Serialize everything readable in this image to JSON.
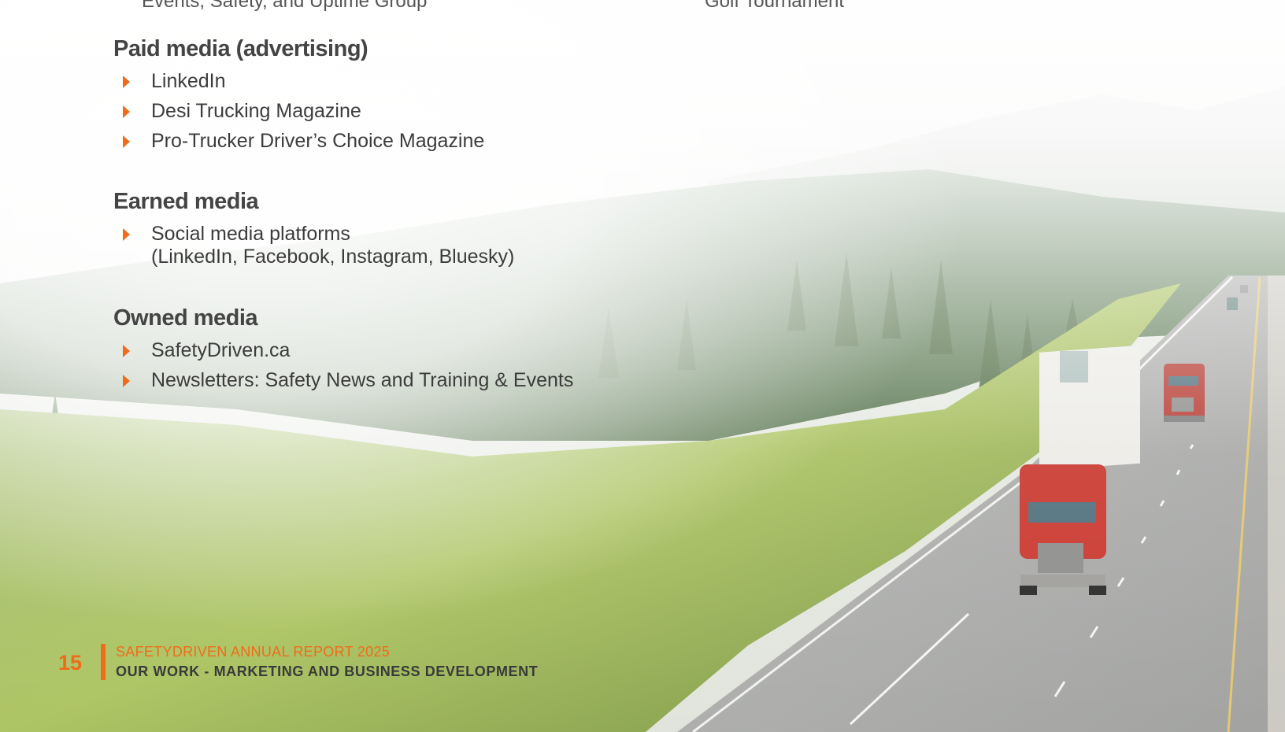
{
  "header_cut": {
    "left_text": "Events, Safety, and Uptime Group",
    "right_text": "Golf Tournament"
  },
  "sections": [
    {
      "heading": "Paid media (advertising)",
      "items": [
        "LinkedIn",
        "Desi Trucking Magazine",
        "Pro-Trucker Driver’s Choice Magazine"
      ]
    },
    {
      "heading": "Earned media",
      "items": [
        "Social media platforms"
      ],
      "item_continuation": "(LinkedIn, Facebook, Instagram, Bluesky)"
    },
    {
      "heading": "Owned media",
      "items": [
        "SafetyDriven.ca",
        "Newsletters: Safety News and Training & Events"
      ]
    }
  ],
  "footer": {
    "page_number": "15",
    "report_title": "SAFETYDRIVEN ANNUAL REPORT 2025",
    "section_title": "OUR WORK - MARKETING AND BUSINESS DEVELOPMENT"
  },
  "colors": {
    "accent": "#ef6c1a",
    "heading": "#444444",
    "body_text": "#3c3c3c"
  }
}
